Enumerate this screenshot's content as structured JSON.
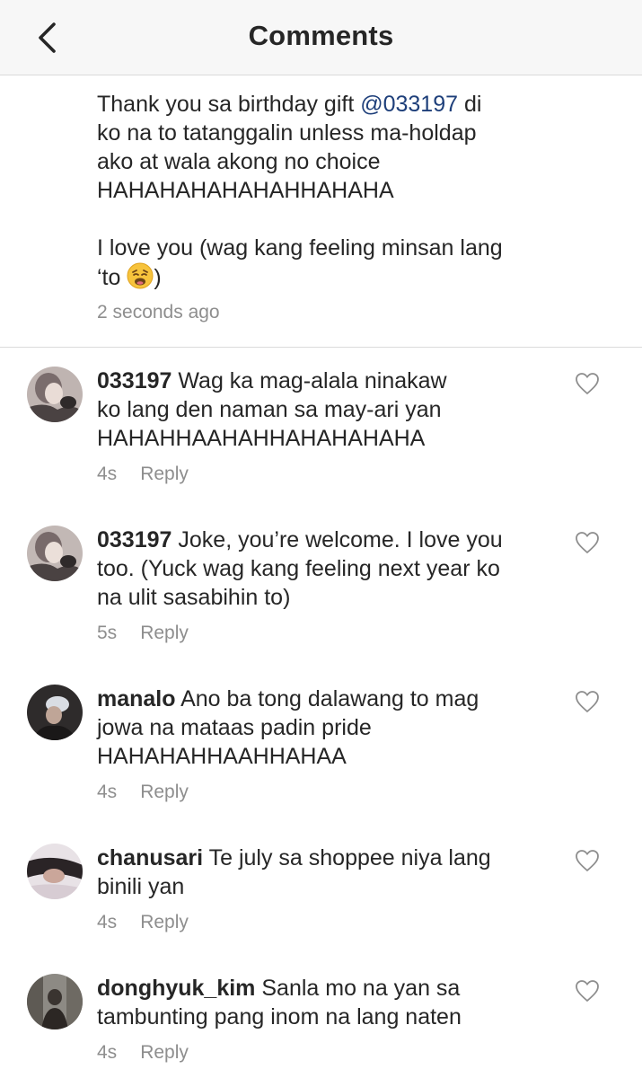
{
  "header": {
    "title": "Comments",
    "back_icon": "chevron-left-icon"
  },
  "caption": {
    "line1_pre": "Thank you sa birthday gift ",
    "mention": "@033197",
    "line1_post": " di",
    "line2": "ko na to tatanggalin unless ma-holdap",
    "line3": "ako at wala akong no choice",
    "line4": "HAHAHAHAHAHAHHAHAHA",
    "line5": "I love you (wag kang feeling minsan lang",
    "line6_pre": "‘to ",
    "line6_emoji": "weary-face-emoji",
    "line6_post": ")",
    "time": "2 seconds ago"
  },
  "comments": [
    {
      "username": "033197",
      "lines": [
        " Wag ka mag-alala ninakaw",
        "ko lang den naman sa may-ari yan",
        "HAHAHHAAHAHHAHAHAHAHA"
      ],
      "time": "4s",
      "reply": "Reply"
    },
    {
      "username": "033197",
      "lines": [
        " Joke, you’re welcome. I love you",
        "too. (Yuck wag kang feeling next year ko",
        "na ulit sasabihin to)"
      ],
      "time": "5s",
      "reply": "Reply"
    },
    {
      "username": "manalo",
      "lines": [
        " Ano ba tong dalawang to mag",
        "jowa na mataas padin pride",
        "HAHAHAHHAAHHAHAA"
      ],
      "time": "4s",
      "reply": "Reply"
    },
    {
      "username": "chanusari",
      "lines": [
        " Te july sa shoppee niya lang",
        "binili yan"
      ],
      "time": "4s",
      "reply": "Reply"
    },
    {
      "username": "donghyuk_kim",
      "lines": [
        " Sanla mo na yan sa",
        "tambunting pang inom na lang naten"
      ],
      "time": "4s",
      "reply": "Reply"
    }
  ],
  "colors": {
    "mention": "#1e3f7a",
    "meta": "#8e8e8e",
    "text": "#262626",
    "header_bg": "#f7f7f7"
  }
}
